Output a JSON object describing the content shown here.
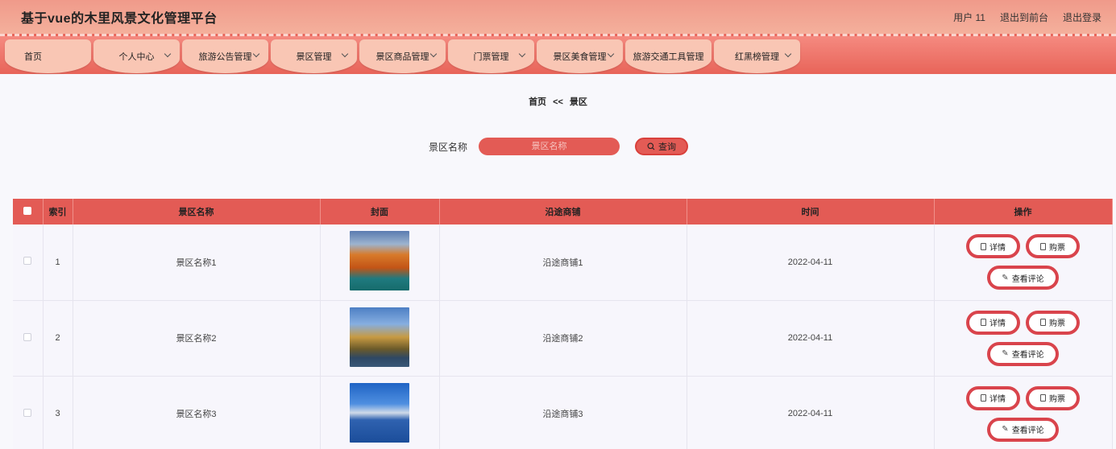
{
  "header": {
    "title": "基于vue的木里风景文化管理平台",
    "user_label": "用户 11",
    "front_label": "退出到前台",
    "logout_label": "退出登录"
  },
  "nav": {
    "items": [
      {
        "label": "首页",
        "has_dropdown": false
      },
      {
        "label": "个人中心",
        "has_dropdown": true
      },
      {
        "label": "旅游公告管理",
        "has_dropdown": true
      },
      {
        "label": "景区管理",
        "has_dropdown": true
      },
      {
        "label": "景区商品管理",
        "has_dropdown": true
      },
      {
        "label": "门票管理",
        "has_dropdown": true
      },
      {
        "label": "景区美食管理",
        "has_dropdown": true
      },
      {
        "label": "旅游交通工具管理",
        "has_dropdown": false
      },
      {
        "label": "红黑榜管理",
        "has_dropdown": true
      }
    ]
  },
  "breadcrumb": {
    "home": "首页",
    "separator": "<<",
    "current": "景区"
  },
  "search": {
    "label": "景区名称",
    "placeholder": "景区名称",
    "button_label": "查询"
  },
  "table": {
    "columns": {
      "index": "索引",
      "name": "景区名称",
      "cover": "封面",
      "shops": "沿途商铺",
      "time": "时间",
      "actions": "操作"
    },
    "rows": [
      {
        "index": "1",
        "name": "景区名称1",
        "shops": "沿途商铺1",
        "time": "2022-04-11"
      },
      {
        "index": "2",
        "name": "景区名称2",
        "shops": "沿途商铺2",
        "time": "2022-04-11"
      },
      {
        "index": "3",
        "name": "景区名称3",
        "shops": "沿途商铺3",
        "time": "2022-04-11"
      }
    ],
    "action_labels": {
      "detail": "详情",
      "buy": "购票",
      "comments": "查看评论"
    }
  },
  "colors": {
    "accent": "#e35b55",
    "header_bg": "#f09a8a",
    "button_border": "#d9444c"
  }
}
